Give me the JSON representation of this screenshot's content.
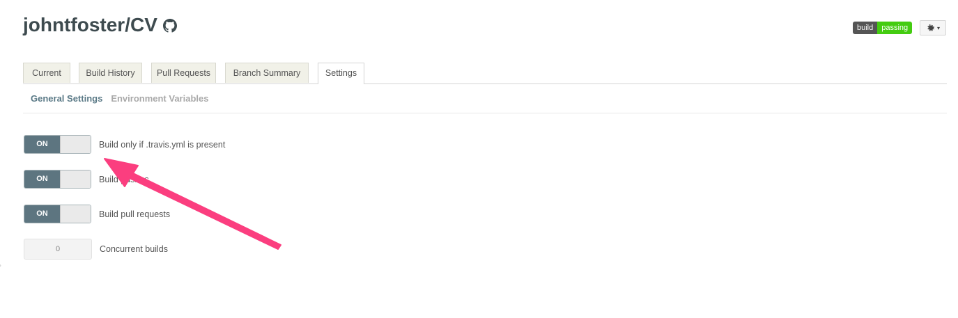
{
  "repo": {
    "title": "johntfoster/CV",
    "icon": "github-icon"
  },
  "badge": {
    "left": "build",
    "right": "passing",
    "left_color": "#555555",
    "right_color": "#44cc11"
  },
  "settings_menu": {
    "icon": "gear-icon",
    "caret": "▾"
  },
  "tabs": [
    {
      "label": "Current"
    },
    {
      "label": "Build History"
    },
    {
      "label": "Pull Requests"
    },
    {
      "label": "Branch Summary"
    },
    {
      "label": "Settings",
      "active": true
    }
  ],
  "subnav": {
    "general": "General Settings",
    "env": "Environment Variables"
  },
  "settings": [
    {
      "toggle": "ON",
      "label": "Build only if .travis.yml is present"
    },
    {
      "toggle": "ON",
      "label": "Build pushes"
    },
    {
      "toggle": "ON",
      "label": "Build pull requests"
    }
  ],
  "concurrent": {
    "value": "0",
    "label": "Concurrent builds"
  },
  "annotation": {
    "type": "arrow",
    "color": "#fb3e7f",
    "icon": "pink-arrow-annotation"
  },
  "colors": {
    "accent": "#5d7580",
    "tab_bg": "#f1f1e8"
  }
}
